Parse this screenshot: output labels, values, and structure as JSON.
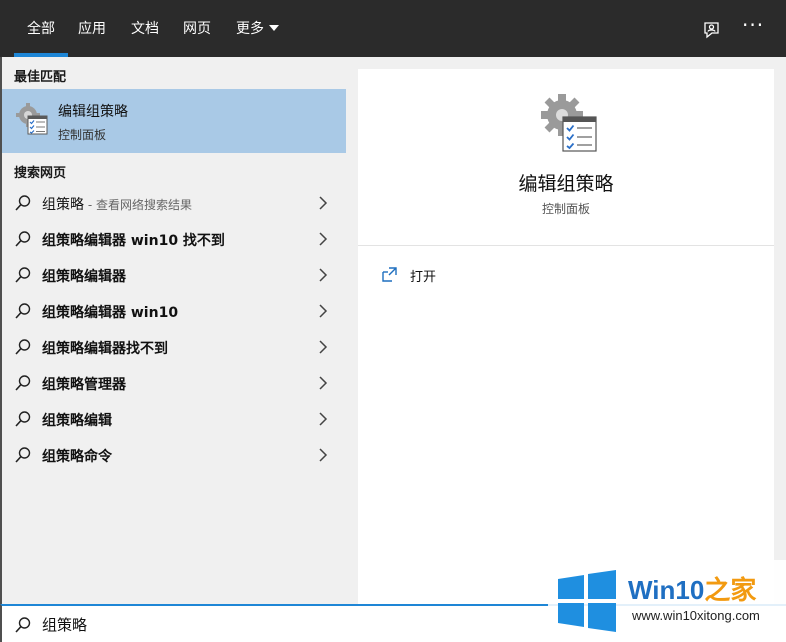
{
  "header": {
    "tabs": [
      {
        "label": "全部",
        "active": true
      },
      {
        "label": "应用"
      },
      {
        "label": "文档"
      },
      {
        "label": "网页"
      },
      {
        "label": "更多"
      }
    ],
    "feedback_icon": "feedback-icon",
    "more_options_icon": "ellipsis-icon",
    "more_options_label": "···"
  },
  "left_pane": {
    "best_match_heading": "最佳匹配",
    "best_match": {
      "title": "编辑组策略",
      "subtitle": "控制面板",
      "icon": "group-policy-icon"
    },
    "web_heading": "搜索网页",
    "web_results": [
      {
        "label": "组策略",
        "suffix": " - 查看网络搜索结果",
        "bold": false
      },
      {
        "label": "组策略编辑器 win10 找不到",
        "bold": true
      },
      {
        "label": "组策略编辑器",
        "bold": true
      },
      {
        "label": "组策略编辑器 win10",
        "bold": true
      },
      {
        "label": "组策略编辑器找不到",
        "bold": true
      },
      {
        "label": "组策略管理器",
        "bold": true
      },
      {
        "label": "组策略编辑",
        "bold": true
      },
      {
        "label": "组策略命令",
        "bold": true
      }
    ]
  },
  "preview": {
    "title": "编辑组策略",
    "subtitle": "控制面板",
    "actions": [
      {
        "label": "打开",
        "icon": "open-icon"
      }
    ]
  },
  "search": {
    "value": "组策略"
  },
  "watermark": {
    "brand_prefix": "Win10",
    "brand_suffix": "之家",
    "url": "www.win10xitong.com"
  },
  "colors": {
    "header_bg": "#2b2b2b",
    "accent": "#1e86d6",
    "selected_bg": "#a9c9e6",
    "pane_bg": "#f0f0f0"
  }
}
